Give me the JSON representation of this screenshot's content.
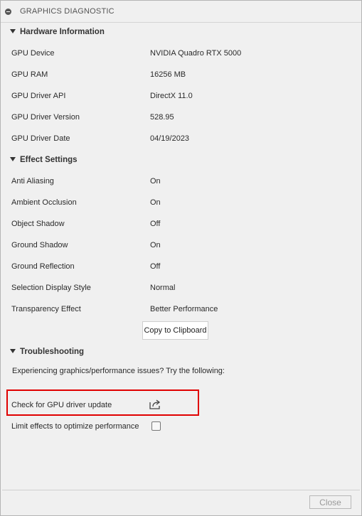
{
  "window": {
    "title": "GRAPHICS DIAGNOSTIC"
  },
  "hardware": {
    "heading": "Hardware Information",
    "rows": [
      {
        "label": "GPU Device",
        "value": "NVIDIA Quadro RTX 5000"
      },
      {
        "label": "GPU RAM",
        "value": "16256 MB"
      },
      {
        "label": "GPU Driver API",
        "value": "DirectX 11.0"
      },
      {
        "label": "GPU Driver Version",
        "value": "528.95"
      },
      {
        "label": "GPU Driver Date",
        "value": "04/19/2023"
      }
    ]
  },
  "effects": {
    "heading": "Effect Settings",
    "rows": [
      {
        "label": "Anti Aliasing",
        "value": "On"
      },
      {
        "label": "Ambient Occlusion",
        "value": "On"
      },
      {
        "label": "Object Shadow",
        "value": "Off"
      },
      {
        "label": "Ground Shadow",
        "value": "On"
      },
      {
        "label": "Ground Reflection",
        "value": "Off"
      },
      {
        "label": "Selection Display Style",
        "value": "Normal"
      },
      {
        "label": "Transparency Effect",
        "value": "Better Performance"
      }
    ],
    "copy_button": "Copy to Clipboard"
  },
  "troubleshooting": {
    "heading": "Troubleshooting",
    "intro": "Experiencing graphics/performance issues? Try the following:",
    "gpu_update_label": "Check for GPU driver update",
    "gpu_update_icon": "external-link-icon",
    "limit_effects_label": "Limit effects to optimize performance",
    "limit_effects_checked": false
  },
  "footer": {
    "close_label": "Close"
  },
  "colors": {
    "highlight": "#e00000",
    "dialog_bg": "#f0f0f0"
  }
}
